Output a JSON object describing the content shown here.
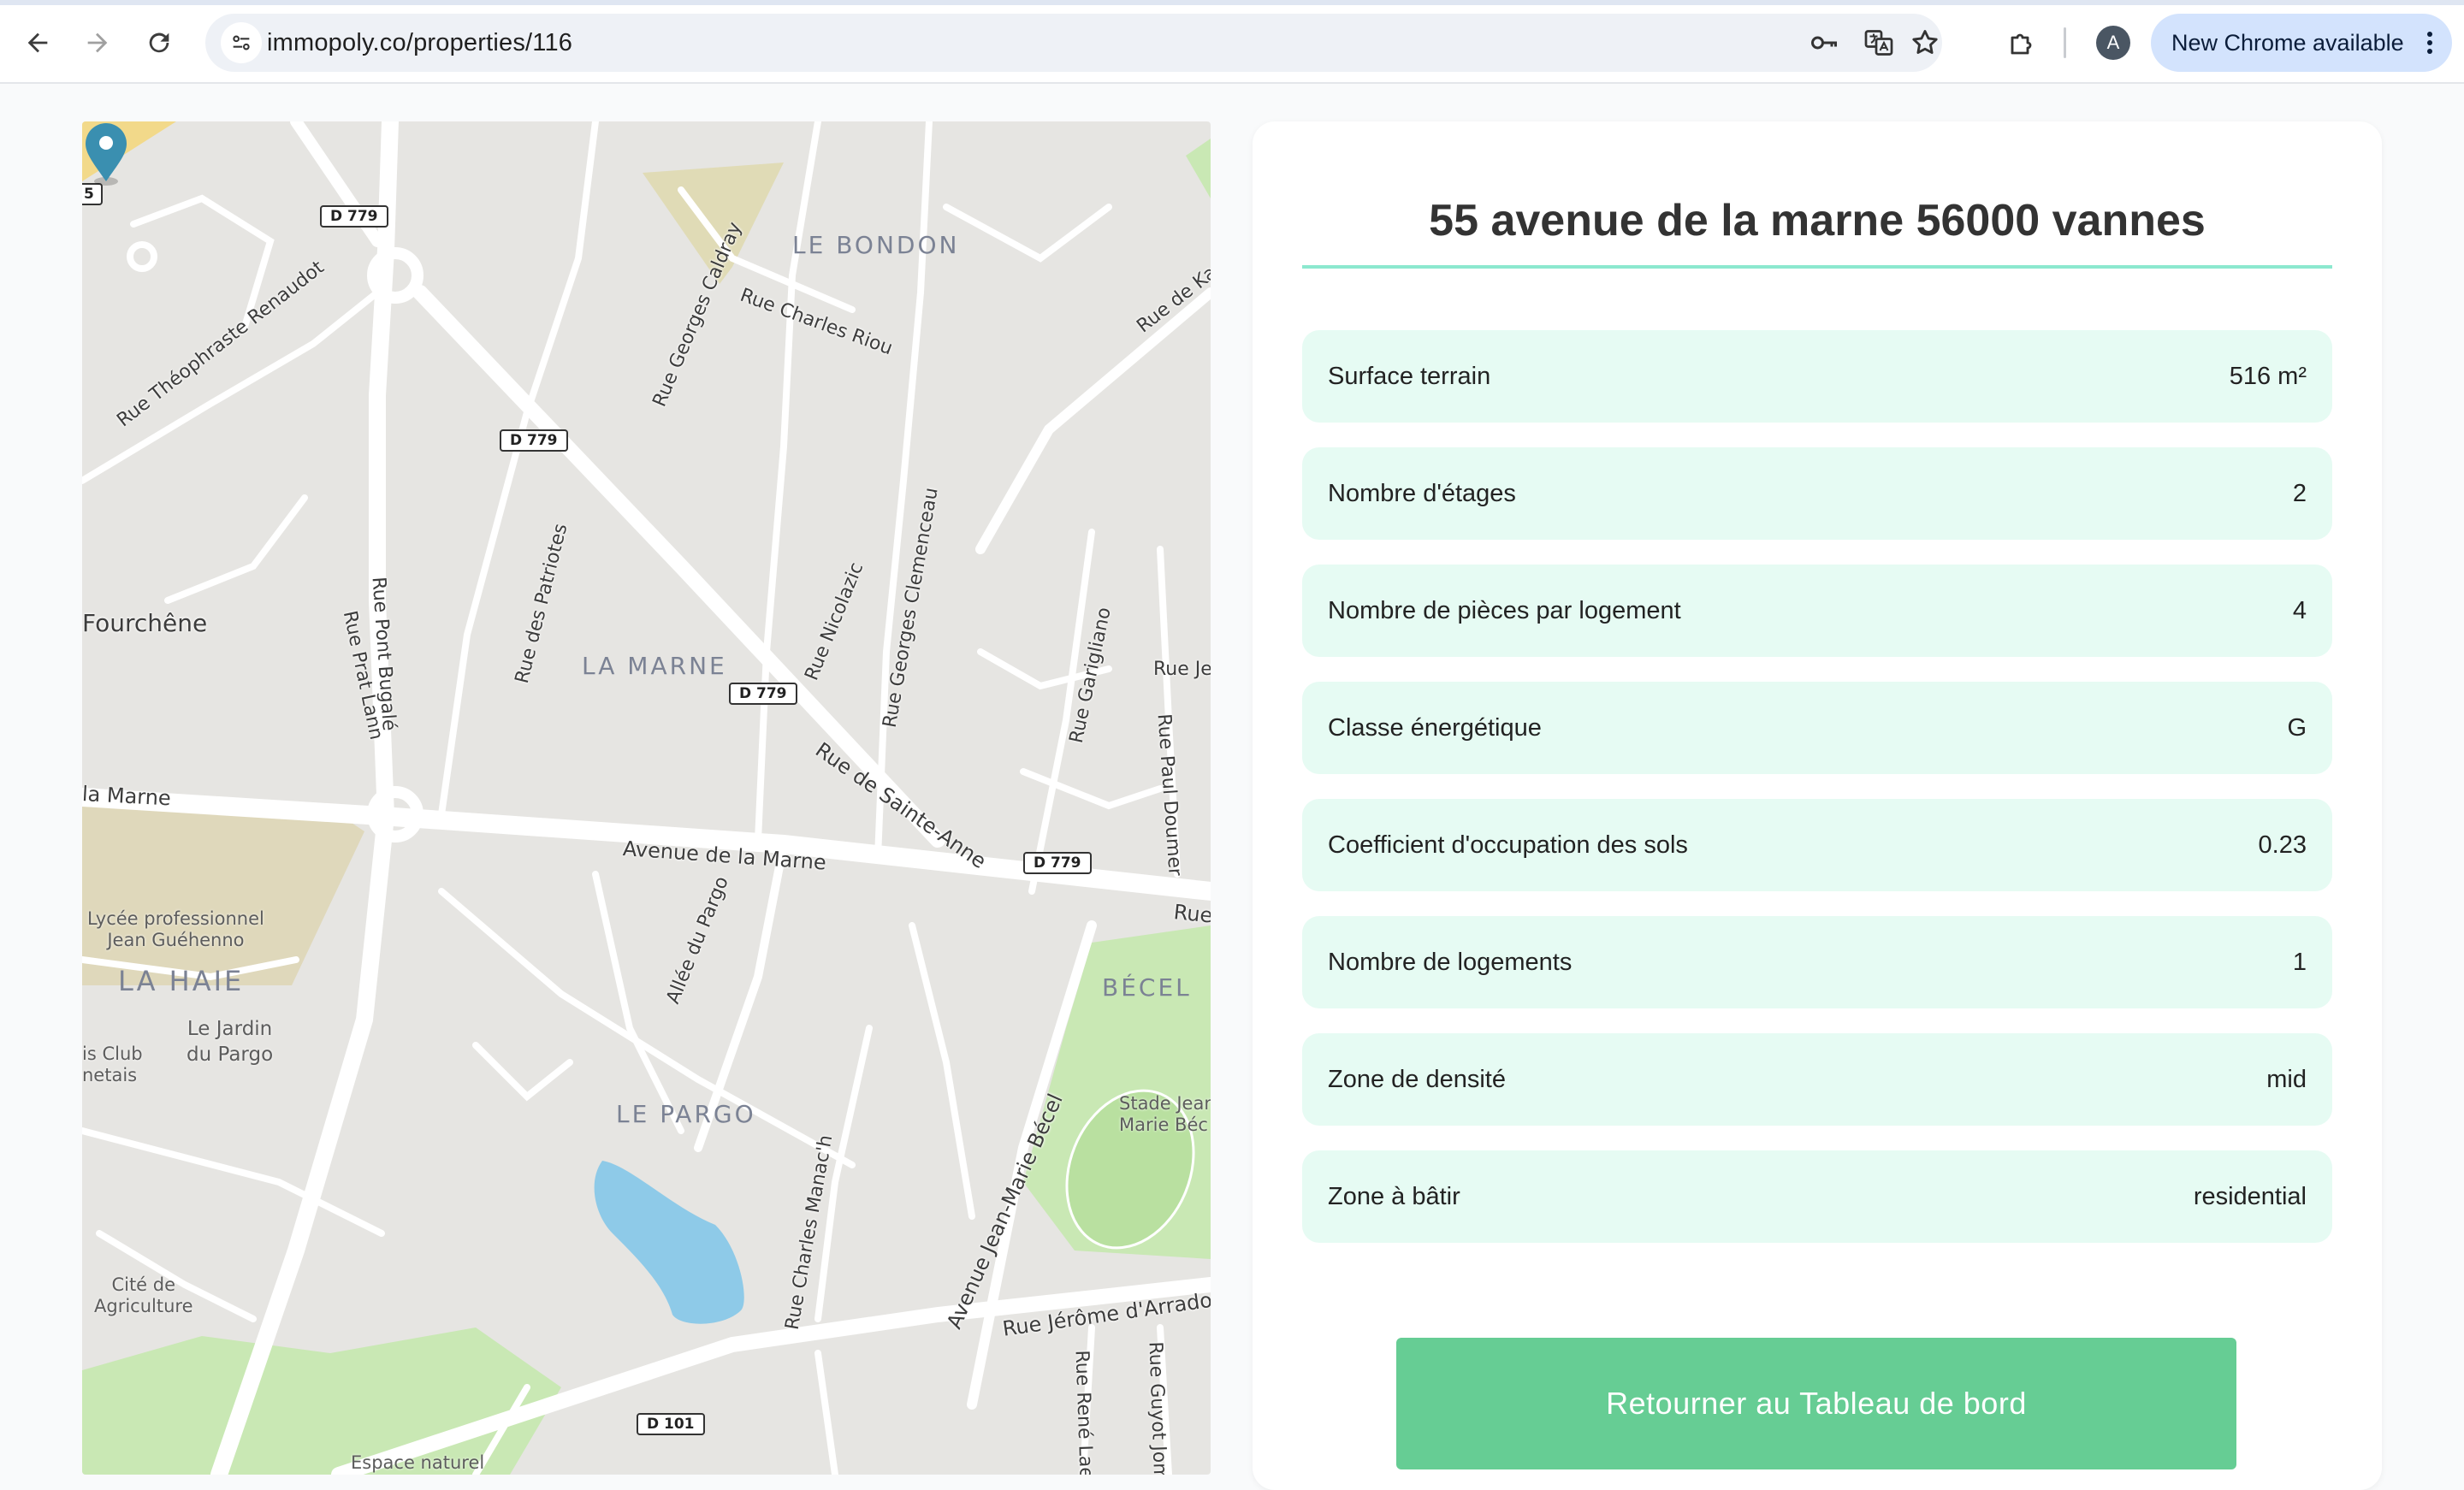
{
  "browser": {
    "url": "immopoly.co/properties/116",
    "avatar_letter": "A",
    "update_button_label": "New Chrome available"
  },
  "map": {
    "districts": [
      "LE BONDON",
      "LA MARNE",
      "LA HAIE",
      "BÉCEL",
      "LE PARGO"
    ],
    "streets": {
      "theophraste": "Rue Théophraste Renaudot",
      "caldray": "Rue Georges Caldray",
      "riou": "Rue Charles Riou",
      "rue_de_k": "Rue de Ka",
      "patriotes": "Rue des Patriotes",
      "pont_bugale": "Rue Pont Bugalé",
      "prat_lann": "Rue Prat Lann",
      "nicolazic": "Rue Nicolazic",
      "clemenceau": "Rue Georges Clemenceau",
      "garigliano": "Rue Garigliano",
      "rue_je": "Rue Je",
      "doumer": "Rue Paul Doumer",
      "sainte_anne": "Rue de Sainte-Anne",
      "avenue_marne": "Avenue de la Marne",
      "la_marne_left": "la Marne",
      "pargo_allee": "Allée du Pargo",
      "manach": "Rue Charles Manac'h",
      "jean_marie_becel": "Avenue Jean-Marie Bécel",
      "arradon": "Rue Jérôme d'Arradon",
      "rene_laenn": "Rue René Laenn",
      "guyot": "Rue Guyot Jomar",
      "rue_right": "Rue",
      "fourchene": "Fourchêne"
    },
    "pois": {
      "lycee": "Lycée professionnel\nJean Guéhenno",
      "jardin": "Le Jardin\ndu Pargo",
      "tennis": "is Club\nnetais",
      "stade": "Stade Jean\nMarie Béc",
      "cite": "Cité de\nAgriculture",
      "espace": "Espace naturel"
    },
    "road_shields": {
      "d779_a": "D 779",
      "d779_b": "D 779",
      "d779_c": "D 779",
      "d779_d": "D 779",
      "d101": "D 101",
      "edge_5": "5"
    }
  },
  "property": {
    "address": "55 avenue de la marne 56000 vannes",
    "details": [
      {
        "label": "Surface terrain",
        "value": "516 m²"
      },
      {
        "label": "Nombre d'étages",
        "value": "2"
      },
      {
        "label": "Nombre de pièces par logement",
        "value": "4"
      },
      {
        "label": "Classe énergétique",
        "value": "G"
      },
      {
        "label": "Coefficient d'occupation des sols",
        "value": "0.23"
      },
      {
        "label": "Nombre de logements",
        "value": "1"
      },
      {
        "label": "Zone de densité",
        "value": "mid"
      },
      {
        "label": "Zone à bâtir",
        "value": "residential"
      }
    ],
    "back_button_label": "Retourner au Tableau de bord"
  },
  "colors": {
    "accent_green": "#66cd94",
    "row_background": "#e6fbf3",
    "title_underline": "#8ce8cf",
    "marker": "#3a8fb0"
  },
  "icons": [
    "back-arrow-icon",
    "forward-arrow-icon",
    "reload-icon",
    "site-settings-icon",
    "password-key-icon",
    "translate-icon",
    "bookmark-star-icon",
    "extensions-icon",
    "more-vert-icon",
    "map-pin-icon"
  ]
}
